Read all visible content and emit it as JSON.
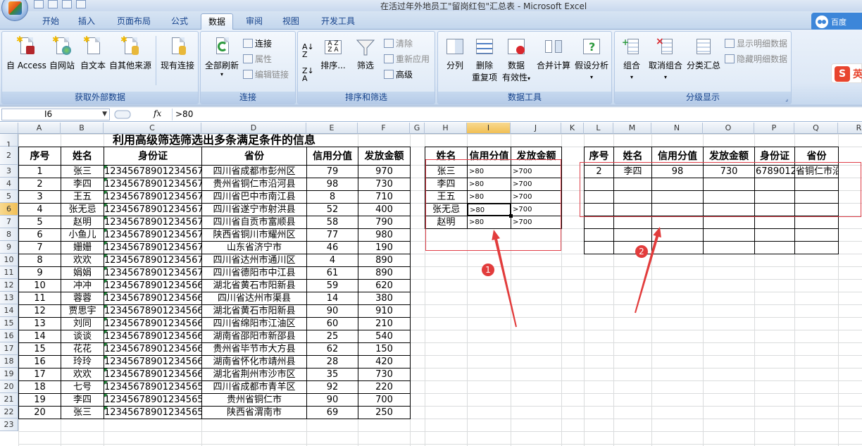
{
  "window": {
    "title": "在活过年外地员工\"留岗红包\"汇总表 - Microsoft Excel"
  },
  "tabs": [
    "开始",
    "插入",
    "页面布局",
    "公式",
    "数据",
    "审阅",
    "视图",
    "开发工具"
  ],
  "active_tab": "数据",
  "ribbon": {
    "get_external": {
      "label": "获取外部数据",
      "buttons": [
        "自 Access",
        "自网站",
        "自文本",
        "自其他来源",
        "现有连接"
      ]
    },
    "connections": {
      "label": "连接",
      "refresh_all": "全部刷新",
      "connections": "连接",
      "properties": "属性",
      "edit_links": "编辑链接"
    },
    "sort_filter": {
      "label": "排序和筛选",
      "sort": "排序...",
      "filter": "筛选",
      "clear": "清除",
      "reapply": "重新应用",
      "advanced": "高级"
    },
    "data_tools": {
      "label": "数据工具",
      "split": "分列",
      "remove_dup_1": "删除",
      "remove_dup_2": "重复项",
      "validation_1": "数据",
      "validation_2": "有效性",
      "consolidate": "合并计算",
      "whatif": "假设分析"
    },
    "outline": {
      "label": "分级显示",
      "group": "组合",
      "ungroup": "取消组合",
      "subtotal": "分类汇总",
      "show_detail": "显示明细数据",
      "hide_detail": "隐藏明细数据"
    },
    "sogou_text": "英",
    "baidu_text": "百度"
  },
  "formula_bar": {
    "name_box": "I6",
    "fx": "fx",
    "content": ">80"
  },
  "columns": [
    "A",
    "B",
    "C",
    "D",
    "E",
    "F",
    "G",
    "H",
    "I",
    "J",
    "K",
    "L",
    "M",
    "N",
    "O",
    "P",
    "Q",
    "R"
  ],
  "rows": [
    "1",
    "2",
    "3",
    "4",
    "5",
    "6",
    "7",
    "8",
    "9",
    "10",
    "11",
    "12",
    "13",
    "14",
    "15",
    "16",
    "17",
    "18",
    "19",
    "20",
    "21",
    "22",
    "23"
  ],
  "sheet": {
    "title": "利用高级筛选筛选出多条满足条件的信息",
    "headers": [
      "序号",
      "姓名",
      "身份证",
      "省份",
      "信用分值",
      "发放金额"
    ],
    "records": [
      [
        "1",
        "张三",
        "123456789012345678",
        "四川省成都市彭州区",
        "79",
        "970"
      ],
      [
        "2",
        "李四",
        "123456789012345677",
        "贵州省铜仁市沿河县",
        "98",
        "730"
      ],
      [
        "3",
        "王五",
        "123456789012345676",
        "四川省巴中市南江县",
        "8",
        "710"
      ],
      [
        "4",
        "张无忌",
        "123456789012345675",
        "四川省遂宁市射洪县",
        "52",
        "400"
      ],
      [
        "5",
        "赵明",
        "123456789012345674",
        "四川省自贡市富顺县",
        "58",
        "790"
      ],
      [
        "6",
        "小鱼儿",
        "123456789012345673",
        "陕西省铜川市耀州区",
        "77",
        "980"
      ],
      [
        "7",
        "姗姗",
        "123456789012345672",
        "山东省济宁市",
        "46",
        "190"
      ],
      [
        "8",
        "欢欢",
        "123456789012345671",
        "四川省达州市通川区",
        "4",
        "890"
      ],
      [
        "9",
        "娟娟",
        "123456789012345670",
        "四川省德阳市中江县",
        "61",
        "890"
      ],
      [
        "10",
        "冲冲",
        "123456789012345668",
        "湖北省黄石市阳新县",
        "59",
        "620"
      ],
      [
        "11",
        "蓉蓉",
        "123456789012345667",
        "四川省达州市渠县",
        "14",
        "380"
      ],
      [
        "12",
        "贾思宇",
        "123456789012345666",
        "湖北省黄石市阳新县",
        "90",
        "910"
      ],
      [
        "13",
        "刘同",
        "123456789012345665",
        "四川省绵阳市江油区",
        "60",
        "210"
      ],
      [
        "14",
        "谈谈",
        "123456789012345664",
        "湖南省邵阳市新邵县",
        "25",
        "540"
      ],
      [
        "15",
        "花花",
        "123456789012345663",
        "贵州省毕节市大方县",
        "62",
        "150"
      ],
      [
        "16",
        "玲玲",
        "123456789012345662",
        "湖南省怀化市靖州县",
        "28",
        "420"
      ],
      [
        "17",
        "欢欢",
        "123456789012345661",
        "湖北省荆州市沙市区",
        "35",
        "730"
      ],
      [
        "18",
        "七号",
        "123456789012345655",
        "四川省成都市青羊区",
        "92",
        "220"
      ],
      [
        "19",
        "李四",
        "123456789012345654",
        "贵州省铜仁市",
        "90",
        "700"
      ],
      [
        "20",
        "张三",
        "123456789012345653",
        "陕西省渭南市",
        "69",
        "250"
      ]
    ],
    "criteria": {
      "headers": [
        "姓名",
        "信用分值",
        "发放金额"
      ],
      "rows": [
        [
          "张三",
          ">80",
          ">700"
        ],
        [
          "李四",
          ">80",
          ">700"
        ],
        [
          "王五",
          ">80",
          ">700"
        ],
        [
          "张无忌",
          ">80",
          ">700"
        ],
        [
          "赵明",
          ">80",
          ">700"
        ]
      ]
    },
    "result": {
      "headers": [
        "序号",
        "姓名",
        "信用分值",
        "发放金额",
        "身份证",
        "省份"
      ],
      "row": [
        "2",
        "李四",
        "98",
        "730",
        "67890123",
        "省铜仁市沿河县"
      ]
    }
  },
  "annotations": [
    "1",
    "2"
  ]
}
